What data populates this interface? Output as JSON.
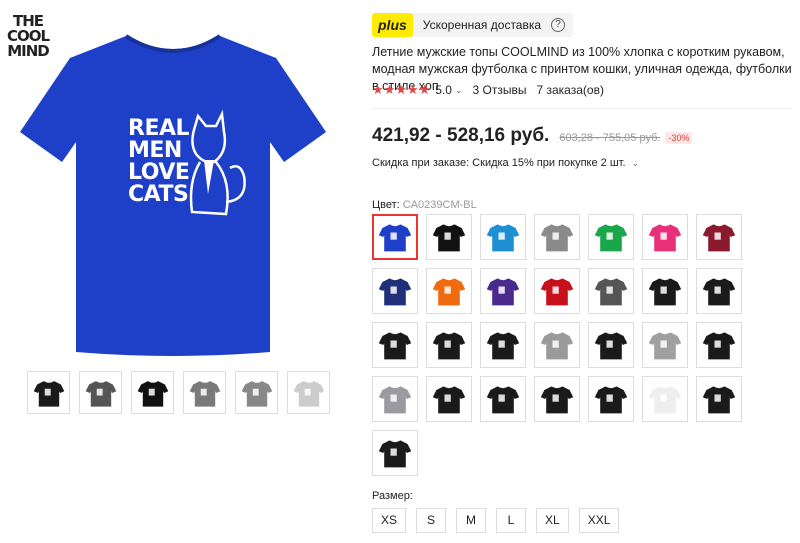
{
  "gallery": {
    "brand_logo": [
      "THE",
      "COOL",
      "MIND"
    ],
    "shirt_print": [
      "REAL",
      "MEN",
      "LOVE",
      "CATS"
    ],
    "shirt_color": "#1e3fc8",
    "thumbnails": [
      {
        "color": "#1a1a1a"
      },
      {
        "color": "#555555"
      },
      {
        "color": "#111111"
      },
      {
        "color": "#7a7a7a"
      },
      {
        "color": "#888888"
      },
      {
        "color": "#cccccc"
      }
    ]
  },
  "shipping": {
    "plus_label": "plus",
    "text": "Ускоренная доставка",
    "help_icon": "?"
  },
  "product": {
    "title": "Летние мужские топы COOLMIND из 100% хлопка с коротким рукавом, модная мужская футболка с принтом кошки, уличная одежда, футболки в стиле хоп",
    "stars": "★★★★★",
    "rating": "5.0",
    "reviews": "3 Отзывы",
    "orders": "7 заказа(ов)"
  },
  "pricing": {
    "price": "421,92 - 528,16 руб.",
    "old_price": "603,28 - 755,05 руб.",
    "discount": "-30%",
    "bulk_discount": "Скидка при заказе: Скидка 15% при покупке 2 шт."
  },
  "color": {
    "label": "Цвет:",
    "selected": "CA0239CM-BL",
    "swatches": [
      "#1e3fc8",
      "#111111",
      "#1e8fd0",
      "#8a8a8a",
      "#1aa64a",
      "#e8307a",
      "#8b1a2e",
      "#1f2f7a",
      "#f06a10",
      "#4a2a8a",
      "#c8101a",
      "#555555",
      "#1a1a1a",
      "#1a1a1a",
      "#1a1a1a",
      "#1a1a1a",
      "#1a1a1a",
      "#9a9a9a",
      "#1a1a1a",
      "#a0a0a0",
      "#1a1a1a",
      "#9a9aa0",
      "#1a1a1a",
      "#1a1a1a",
      "#1a1a1a",
      "#1a1a1a",
      "#eeeeee",
      "#1a1a1a",
      "#1a1a1a"
    ]
  },
  "size": {
    "label": "Размер:",
    "options": [
      "XS",
      "S",
      "M",
      "L",
      "XL",
      "XXL"
    ]
  }
}
